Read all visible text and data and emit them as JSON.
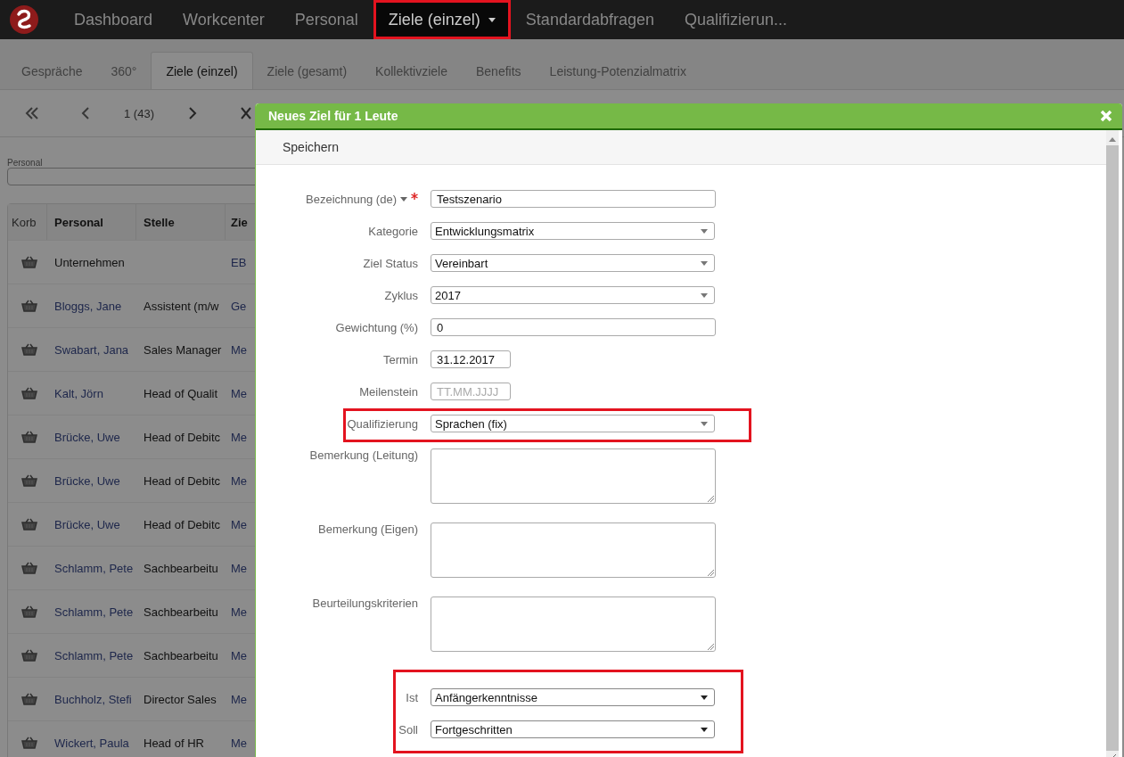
{
  "nav": {
    "items": [
      {
        "label": "Dashboard",
        "selected": false,
        "dropdown": false,
        "highlighted": false
      },
      {
        "label": "Workcenter",
        "selected": false,
        "dropdown": false,
        "highlighted": false
      },
      {
        "label": "Personal",
        "selected": false,
        "dropdown": false,
        "highlighted": false
      },
      {
        "label": "Ziele (einzel)",
        "selected": true,
        "dropdown": true,
        "highlighted": true
      },
      {
        "label": "Standardabfragen",
        "selected": false,
        "dropdown": false,
        "highlighted": false
      },
      {
        "label": "Qualifizierun...",
        "selected": false,
        "dropdown": false,
        "highlighted": false
      }
    ]
  },
  "tabs": [
    {
      "label": "Gespräche",
      "selected": false
    },
    {
      "label": "360°",
      "selected": false
    },
    {
      "label": "Ziele (einzel)",
      "selected": true
    },
    {
      "label": "Ziele (gesamt)",
      "selected": false
    },
    {
      "label": "Kollektivziele",
      "selected": false
    },
    {
      "label": "Benefits",
      "selected": false
    },
    {
      "label": "Leistung-Potenzialmatrix",
      "selected": false
    }
  ],
  "pager": {
    "page_info": "1 (43)"
  },
  "filter": {
    "label": "Personal"
  },
  "table": {
    "columns": [
      "Korb",
      "Personal",
      "Stelle",
      "Zie"
    ],
    "rows": [
      {
        "personal": "Unternehmen",
        "linked": false,
        "stelle": "",
        "column_4": "EB"
      },
      {
        "personal": "Bloggs, Jane",
        "linked": true,
        "stelle": "Assistent (m/w",
        "column_4": "Ge"
      },
      {
        "personal": "Swabart, Jana",
        "linked": true,
        "stelle": "Sales Manager",
        "column_4": "Me"
      },
      {
        "personal": "Kalt, Jörn",
        "linked": true,
        "stelle": "Head of Qualit",
        "column_4": "Me"
      },
      {
        "personal": "Brücke, Uwe",
        "linked": true,
        "stelle": "Head of Debitc",
        "column_4": "Me"
      },
      {
        "personal": "Brücke, Uwe",
        "linked": true,
        "stelle": "Head of Debitc",
        "column_4": "Me"
      },
      {
        "personal": "Brücke, Uwe",
        "linked": true,
        "stelle": "Head of Debitc",
        "column_4": "Me"
      },
      {
        "personal": "Schlamm, Pete",
        "linked": true,
        "stelle": "Sachbearbeitu",
        "column_4": "Me"
      },
      {
        "personal": "Schlamm, Pete",
        "linked": true,
        "stelle": "Sachbearbeitu",
        "column_4": "Me"
      },
      {
        "personal": "Schlamm, Pete",
        "linked": true,
        "stelle": "Sachbearbeitu",
        "column_4": "Me"
      },
      {
        "personal": "Buchholz, Stefi",
        "linked": true,
        "stelle": "Director Sales",
        "column_4": "Me"
      },
      {
        "personal": "Wickert, Paula",
        "linked": true,
        "stelle": "Head of HR",
        "column_4": "Me"
      }
    ]
  },
  "modal": {
    "title": "Neues Ziel für 1 Leute",
    "toolbar_button": "Speichern",
    "fields": [
      {
        "kind": "text",
        "label": "Bezeichnung (de)",
        "value": "Testszenario",
        "required": true,
        "language_menu": true,
        "highlighted": false
      },
      {
        "kind": "select",
        "label": "Kategorie",
        "value": "Entwicklungsmatrix",
        "highlighted": false
      },
      {
        "kind": "select",
        "label": "Ziel Status",
        "value": "Vereinbart",
        "highlighted": false
      },
      {
        "kind": "select",
        "label": "Zyklus",
        "value": "2017",
        "highlighted": false
      },
      {
        "kind": "text",
        "label": "Gewichtung (%)",
        "value": "0",
        "highlighted": false
      },
      {
        "kind": "date",
        "label": "Termin",
        "value": "31.12.2017",
        "highlighted": false
      },
      {
        "kind": "date",
        "label": "Meilenstein",
        "placeholder": "TT.MM.JJJJ",
        "highlighted": false
      },
      {
        "kind": "select",
        "label": "Qualifizierung",
        "value": "Sprachen (fix)",
        "highlighted": true
      },
      {
        "kind": "textarea",
        "label": "Bemerkung (Leitung)",
        "highlighted": false
      },
      {
        "kind": "textarea",
        "label": "Bemerkung (Eigen)",
        "highlighted": false
      },
      {
        "kind": "textarea",
        "label": "Beurteilungskriterien",
        "highlighted": false
      }
    ],
    "level_group": {
      "highlighted": true,
      "fields": [
        {
          "label": "Ist",
          "value": "Anfängerkenntnisse"
        },
        {
          "label": "Soll",
          "value": "Fortgeschritten"
        }
      ]
    }
  }
}
